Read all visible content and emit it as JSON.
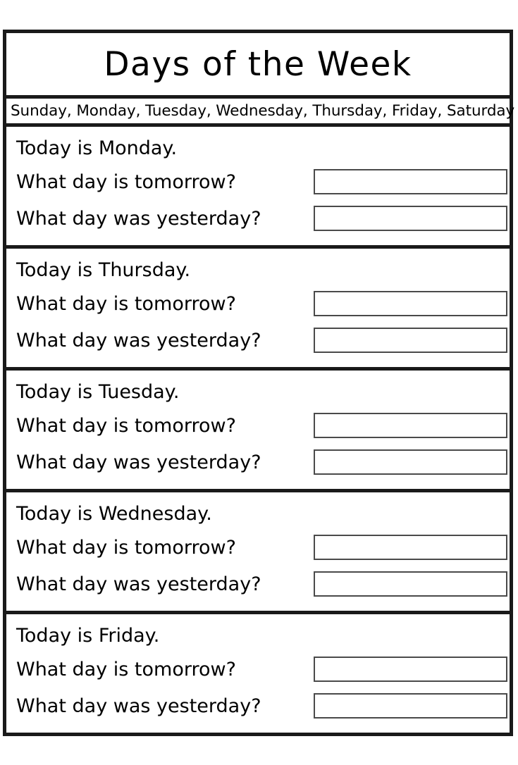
{
  "worksheet": {
    "title": "Days of the Week",
    "day_list": "Sunday, Monday, Tuesday, Wednesday, Thursday, Friday, Saturday",
    "days": [
      "Sunday",
      "Monday",
      "Tuesday",
      "Wednesday",
      "Thursday",
      "Friday",
      "Saturday"
    ],
    "ink_color": "#000000",
    "frame_color": "#1a1a1a",
    "box_border_color": "#4a4a4a",
    "blocks": [
      {
        "statement": "Today is Monday.",
        "question_tomorrow": "What day is tomorrow?",
        "question_yesterday": "What day was yesterday?",
        "answer_tomorrow": "",
        "answer_yesterday": ""
      },
      {
        "statement": "Today is Thursday.",
        "question_tomorrow": "What day is tomorrow?",
        "question_yesterday": "What day was yesterday?",
        "answer_tomorrow": "",
        "answer_yesterday": ""
      },
      {
        "statement": "Today is Tuesday.",
        "question_tomorrow": "What day is tomorrow?",
        "question_yesterday": "What day was yesterday?",
        "answer_tomorrow": "",
        "answer_yesterday": ""
      },
      {
        "statement": "Today is Wednesday.",
        "question_tomorrow": "What day is tomorrow?",
        "question_yesterday": "What day was yesterday?",
        "answer_tomorrow": "",
        "answer_yesterday": ""
      },
      {
        "statement": "Today is Friday.",
        "question_tomorrow": "What day is tomorrow?",
        "question_yesterday": "What day was yesterday?",
        "answer_tomorrow": "",
        "answer_yesterday": ""
      }
    ]
  }
}
